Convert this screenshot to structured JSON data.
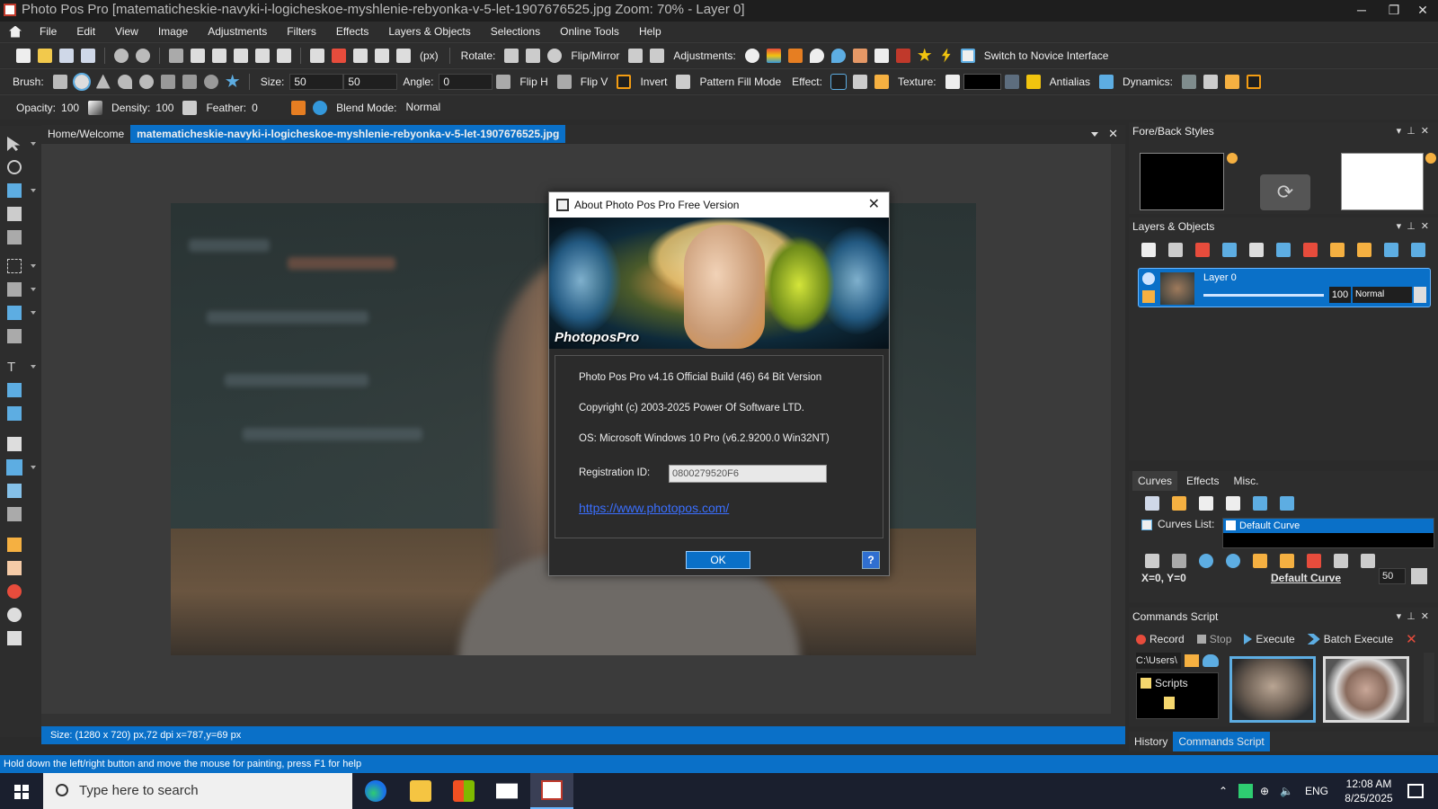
{
  "window": {
    "title": "Photo Pos Pro [matematicheskie-navyki-i-logicheskoe-myshlenie-rebyonka-v-5-let-1907676525.jpg Zoom: 70% - Layer 0]",
    "controls": {
      "minimize": "─",
      "maximize": "❐",
      "close": "✕"
    }
  },
  "menu": [
    "File",
    "Edit",
    "View",
    "Image",
    "Adjustments",
    "Filters",
    "Effects",
    "Layers & Objects",
    "Selections",
    "Online Tools",
    "Help"
  ],
  "toolbar1": {
    "units": "(px)",
    "rotate_label": "Rotate:",
    "flip_label": "Flip/Mirror",
    "adjust_label": "Adjustments:",
    "novice_label": "Switch to Novice Interface"
  },
  "toolbar2": {
    "brush_label": "Brush:",
    "size_label": "Size:",
    "size_w": "50",
    "size_h": "50",
    "angle_label": "Angle:",
    "angle_value": "0",
    "fliph_label": "Flip H",
    "flipv_label": "Flip V",
    "invert_label": "Invert",
    "pattern_label": "Pattern Fill Mode",
    "effect_label": "Effect:",
    "texture_label": "Texture:",
    "antialias_label": "Antialias",
    "dynamics_label": "Dynamics:"
  },
  "toolbar3": {
    "opacity_label": "Opacity:",
    "opacity_value": "100",
    "density_label": "Density:",
    "density_value": "100",
    "feather_label": "Feather:",
    "feather_value": "0",
    "blend_label": "Blend Mode:",
    "blend_value": "Normal"
  },
  "tabs": {
    "home": "Home/Welcome",
    "active": "matematicheskie-navyki-i-logicheskoe-myshlenie-rebyonka-v-5-let-1907676525.jpg",
    "close": "✕"
  },
  "doc_status": "Size: (1280 x 720) px,72 dpi   x=787,y=69 px",
  "hint": "Hold down the left/right button and move the mouse for painting, press F1 for help",
  "panels": {
    "foreback": {
      "title": "Fore/Back Styles",
      "fore_color": "#000000",
      "back_color": "#ffffff"
    },
    "layers": {
      "title": "Layers & Objects",
      "layer_name": "Layer 0",
      "opacity": "100",
      "blend": "Normal"
    },
    "curves": {
      "tabs": [
        "Curves",
        "Effects",
        "Misc."
      ],
      "list_label": "Curves List:",
      "list_item": "Default Curve",
      "coords": "X=0, Y=0",
      "curve_name": "Default Curve",
      "value": "50"
    },
    "commands": {
      "title": "Commands Script",
      "record": "Record",
      "stop": "Stop",
      "execute": "Execute",
      "batch": "Batch Execute",
      "path": "C:\\Users\\",
      "folder": "Scripts"
    },
    "bottom_tabs": [
      "History",
      "Commands Script"
    ]
  },
  "dialog": {
    "title": "About Photo Pos Pro Free Version",
    "banner_text": "PhotoposPro",
    "version": "Photo Pos Pro v4.16 Official Build (46) 64 Bit Version",
    "copyright": "Copyright (c) 2003-2025 Power Of Software LTD.",
    "os": "OS: Microsoft Windows 10 Pro (v6.2.9200.0 Win32NT)",
    "reg_label": "Registration ID:",
    "reg_value": "0800279520F6",
    "url": "https://www.photopos.com/",
    "ok": "OK",
    "help": "?"
  },
  "taskbar": {
    "search_placeholder": "Type here to search",
    "lang": "ENG",
    "time": "12:08 AM",
    "date": "8/25/2025"
  },
  "colors": {
    "accent": "#0a70c8",
    "panel_bg": "#2d2d2d",
    "link": "#3a6fff"
  }
}
